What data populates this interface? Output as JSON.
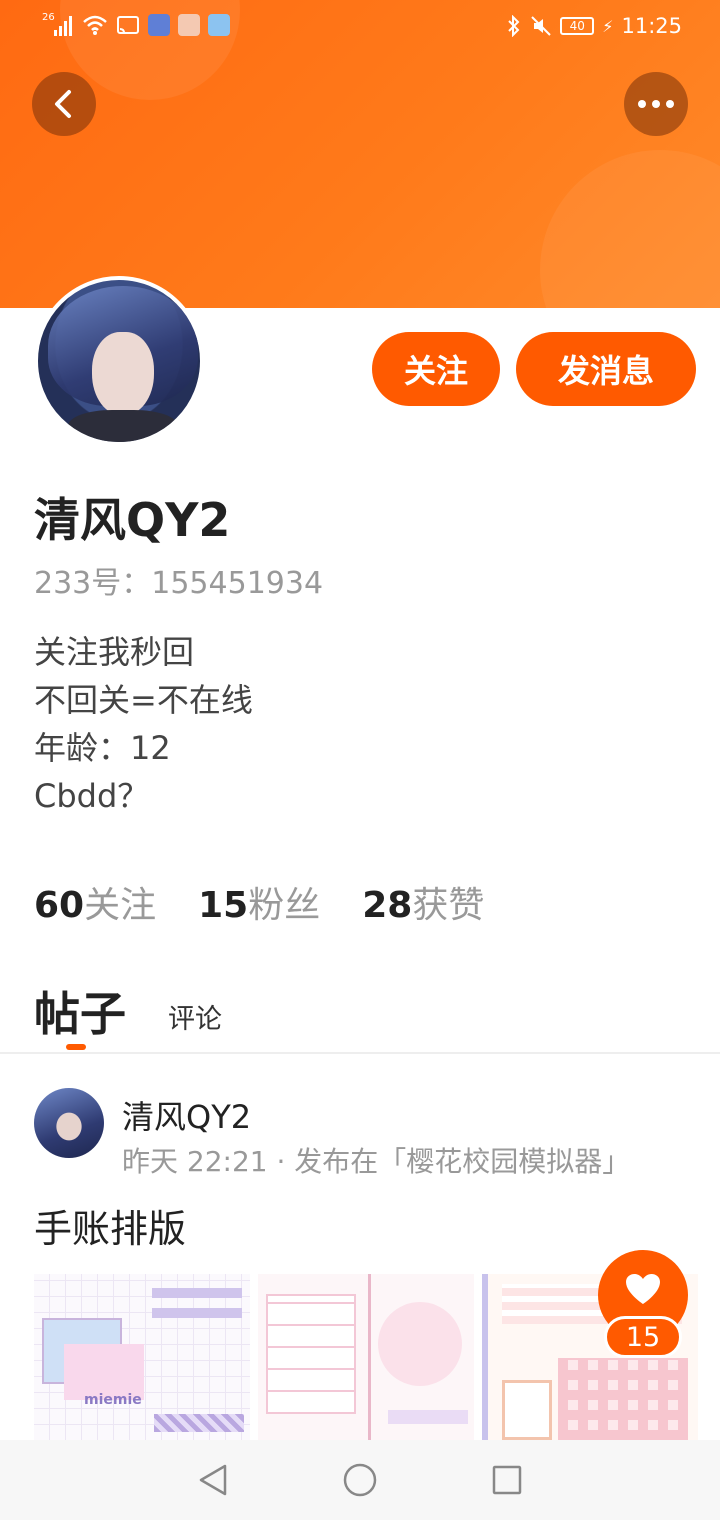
{
  "status_bar": {
    "network_label": "26",
    "battery": "40",
    "time": "11:25"
  },
  "colors": {
    "accent": "#ff5a00",
    "banner": "#ff7a1a"
  },
  "header": {
    "back_icon": "chevron-left-icon",
    "more_icon": "more-dots-icon"
  },
  "profile": {
    "name": "清风QY2",
    "id_text": "233号：155451934",
    "bio": [
      "关注我秒回",
      "不回关=不在线",
      "年龄：12",
      "Cbdd？"
    ],
    "follow_label": "关注",
    "message_label": "发消息",
    "stats": [
      {
        "num": "60",
        "label": "关注"
      },
      {
        "num": "15",
        "label": "粉丝"
      },
      {
        "num": "28",
        "label": "获赞"
      }
    ]
  },
  "tabs": {
    "posts": "帖子",
    "comments": "评论"
  },
  "post": {
    "author": "清风QY2",
    "meta": "昨天 22:21 · 发布在「樱花校园模拟器」",
    "title": "手账排版",
    "thumb_caption": "miemie",
    "likes": "15"
  },
  "navbar": {
    "back_icon": "triangle-back-icon",
    "home_icon": "circle-home-icon",
    "recents_icon": "square-recents-icon"
  }
}
